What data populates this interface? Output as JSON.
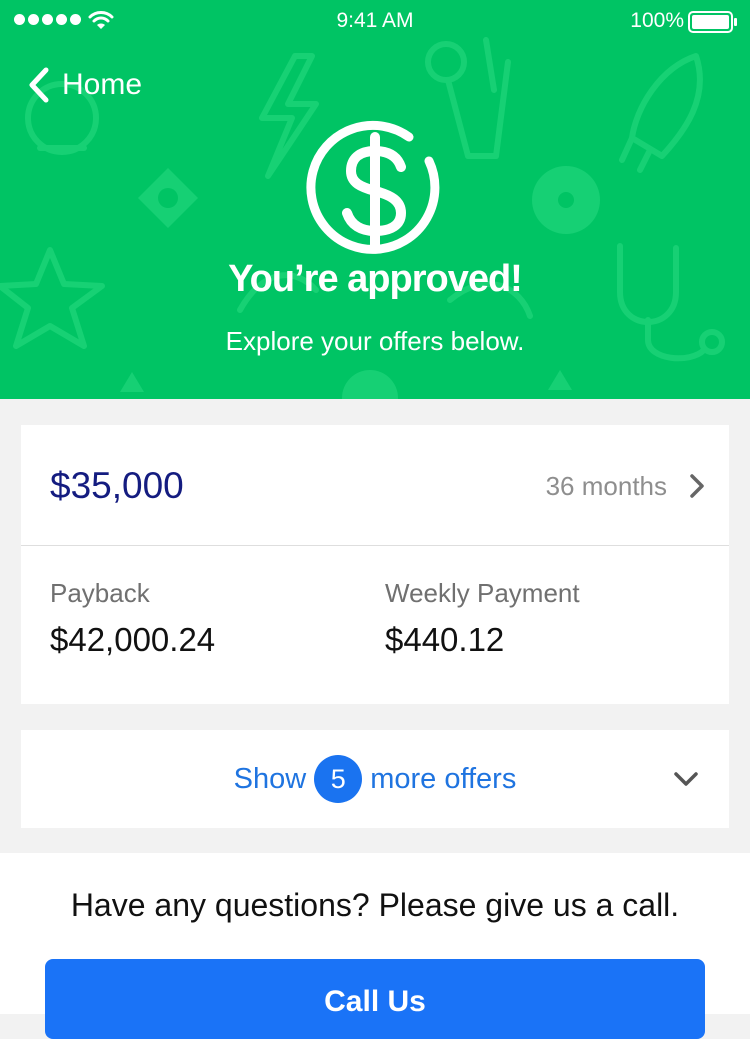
{
  "status_bar": {
    "time": "9:41 AM",
    "battery_percent": "100%",
    "signal_icon": "signal-dots-icon",
    "wifi_icon": "wifi-icon",
    "battery_icon": "battery-icon"
  },
  "nav": {
    "back_label": "Home",
    "back_icon": "chevron-left-icon"
  },
  "hero": {
    "icon": "dollar-circle-icon",
    "title": "You’re approved!",
    "subtitle": "Explore your offers below.",
    "background_color": "#00c464"
  },
  "offer": {
    "amount": "$35,000",
    "term": "36 months",
    "payback_label": "Payback",
    "payback_value": "$42,000.24",
    "weekly_label": "Weekly Payment",
    "weekly_value": "$440.12",
    "amount_color": "#141c80"
  },
  "more_offers": {
    "prefix": "Show",
    "count": "5",
    "suffix": "more offers",
    "icon": "chevron-down-icon",
    "accent_color": "#1f74e0"
  },
  "contact": {
    "question": "Have any questions? Please give us a call.",
    "button_label": "Call Us",
    "button_color": "#1a73f7"
  }
}
